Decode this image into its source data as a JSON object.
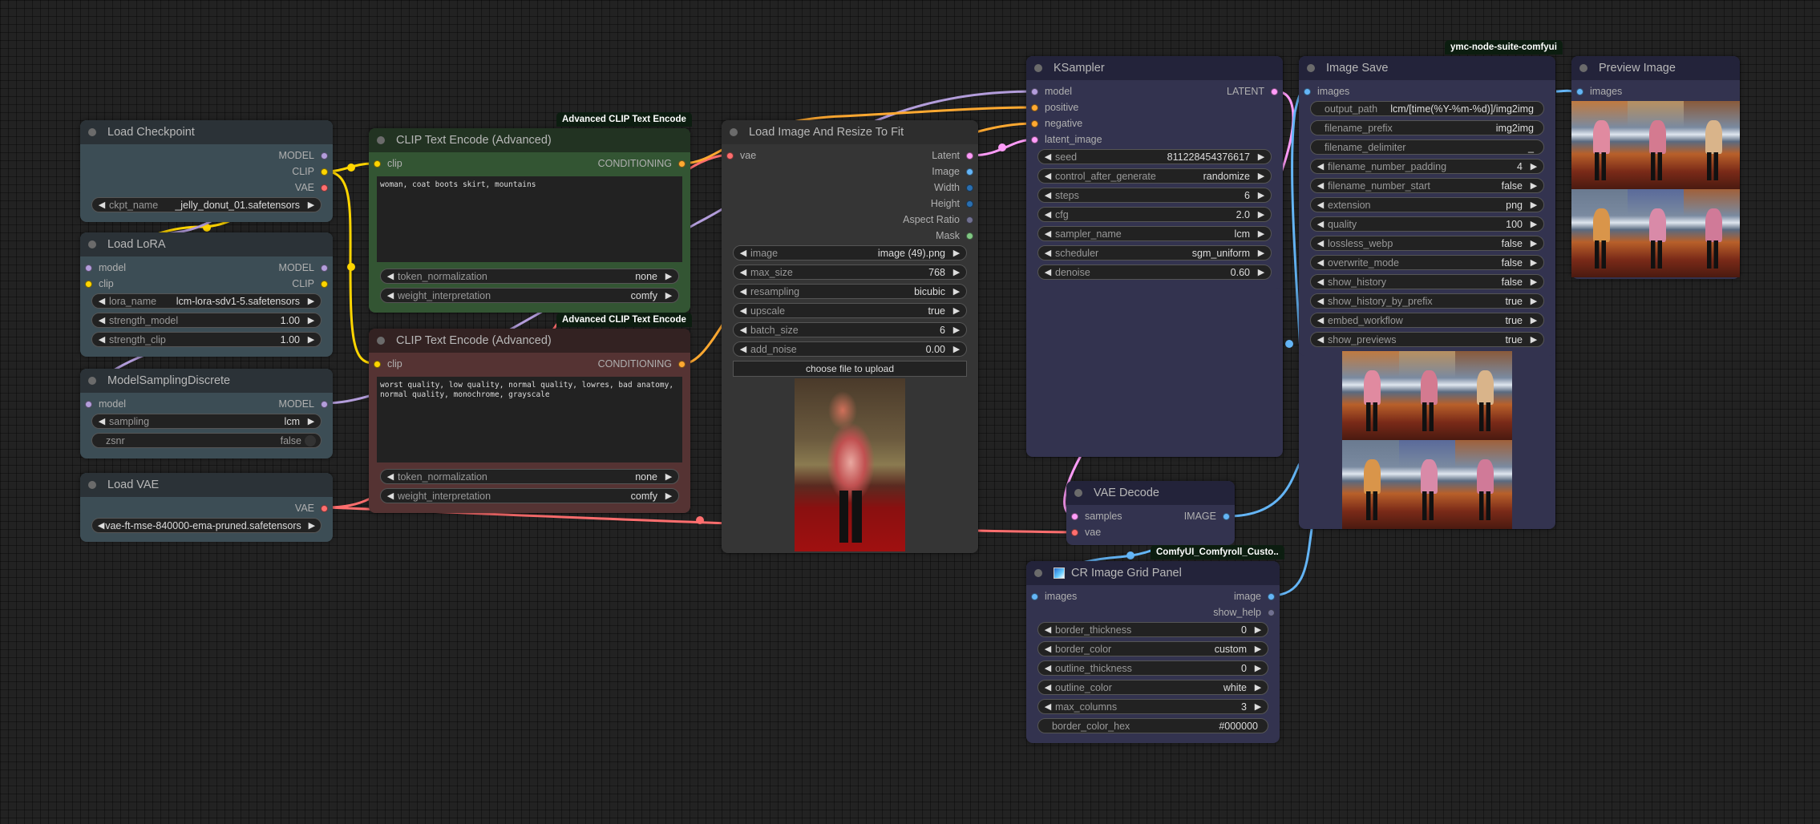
{
  "colors": {
    "model": "#b39ddb",
    "clip": "#ffd500",
    "vae": "#ff6e6e",
    "conditioning": "#ffa931",
    "latent": "#ff9cf9",
    "image": "#64b5f6",
    "int": "#2a6fb0",
    "float": "#707090",
    "mask": "#81c784"
  },
  "nodes": {
    "load_checkpoint": {
      "title": "Load Checkpoint",
      "outputs": [
        "MODEL",
        "CLIP",
        "VAE"
      ],
      "widgets": [
        {
          "name": "ckpt_name",
          "value": "_jelly_donut_01.safetensors"
        }
      ]
    },
    "load_lora": {
      "title": "Load LoRA",
      "inputs": [
        "model",
        "clip"
      ],
      "outputs": [
        "MODEL",
        "CLIP"
      ],
      "widgets": [
        {
          "name": "lora_name",
          "value": "lcm-lora-sdv1-5.safetensors"
        },
        {
          "name": "strength_model",
          "value": "1.00"
        },
        {
          "name": "strength_clip",
          "value": "1.00"
        }
      ]
    },
    "model_sampling": {
      "title": "ModelSamplingDiscrete",
      "inputs": [
        "model"
      ],
      "outputs": [
        "MODEL"
      ],
      "widgets": [
        {
          "name": "sampling",
          "value": "lcm"
        },
        {
          "name": "zsnr",
          "value": "false"
        }
      ]
    },
    "load_vae": {
      "title": "Load VAE",
      "outputs": [
        "VAE"
      ],
      "widgets": [
        {
          "name": "vae_name",
          "value": "vae-ft-mse-840000-ema-pruned.safetensors"
        }
      ]
    },
    "clip_positive": {
      "badge": "Advanced CLIP Text Encode",
      "title": "CLIP Text Encode (Advanced)",
      "inputs": [
        "clip"
      ],
      "outputs": [
        "CONDITIONING"
      ],
      "text": "woman, coat boots skirt, mountains",
      "widgets": [
        {
          "name": "token_normalization",
          "value": "none"
        },
        {
          "name": "weight_interpretation",
          "value": "comfy"
        }
      ]
    },
    "clip_negative": {
      "badge": "Advanced CLIP Text Encode",
      "title": "CLIP Text Encode (Advanced)",
      "inputs": [
        "clip"
      ],
      "outputs": [
        "CONDITIONING"
      ],
      "text": "worst quality, low quality, normal quality, lowres, bad anatomy,\nnormal quality, monochrome, grayscale",
      "widgets": [
        {
          "name": "token_normalization",
          "value": "none"
        },
        {
          "name": "weight_interpretation",
          "value": "comfy"
        }
      ]
    },
    "load_image": {
      "title": "Load Image And Resize To Fit",
      "inputs": [
        "vae"
      ],
      "outputs": [
        "Latent",
        "Image",
        "Width",
        "Height",
        "Aspect Ratio",
        "Mask"
      ],
      "widgets": [
        {
          "name": "image",
          "value": "image (49).png"
        },
        {
          "name": "max_size",
          "value": "768"
        },
        {
          "name": "resampling",
          "value": "bicubic"
        },
        {
          "name": "upscale",
          "value": "true"
        },
        {
          "name": "batch_size",
          "value": "6"
        },
        {
          "name": "add_noise",
          "value": "0.00"
        }
      ],
      "upload_label": "choose file to upload"
    },
    "ksampler": {
      "title": "KSampler",
      "inputs": [
        "model",
        "positive",
        "negative",
        "latent_image"
      ],
      "outputs": [
        "LATENT"
      ],
      "widgets": [
        {
          "name": "seed",
          "value": "811228454376617"
        },
        {
          "name": "control_after_generate",
          "value": "randomize"
        },
        {
          "name": "steps",
          "value": "6"
        },
        {
          "name": "cfg",
          "value": "2.0"
        },
        {
          "name": "sampler_name",
          "value": "lcm"
        },
        {
          "name": "scheduler",
          "value": "sgm_uniform"
        },
        {
          "name": "denoise",
          "value": "0.60"
        }
      ]
    },
    "vae_decode": {
      "title": "VAE Decode",
      "inputs": [
        "samples",
        "vae"
      ],
      "outputs": [
        "IMAGE"
      ]
    },
    "cr_grid": {
      "badge": "ComfyUI_Comfyroll_Custo..",
      "title": "CR Image Grid Panel",
      "inputs": [
        "images"
      ],
      "outputs": [
        "image",
        "show_help"
      ],
      "widgets": [
        {
          "name": "border_thickness",
          "value": "0"
        },
        {
          "name": "border_color",
          "value": "custom"
        },
        {
          "name": "outline_thickness",
          "value": "0"
        },
        {
          "name": "outline_color",
          "value": "white"
        },
        {
          "name": "max_columns",
          "value": "3"
        },
        {
          "name": "border_color_hex",
          "value": "#000000"
        }
      ]
    },
    "image_save": {
      "badge": "ymc-node-suite-comfyui",
      "title": "Image Save",
      "inputs": [
        "images"
      ],
      "widgets": [
        {
          "name": "output_path",
          "value": "lcm/[time(%Y-%m-%d)]/img2img"
        },
        {
          "name": "filename_prefix",
          "value": "img2img"
        },
        {
          "name": "filename_delimiter",
          "value": "_"
        },
        {
          "name": "filename_number_padding",
          "value": "4"
        },
        {
          "name": "filename_number_start",
          "value": "false"
        },
        {
          "name": "extension",
          "value": "png"
        },
        {
          "name": "quality",
          "value": "100"
        },
        {
          "name": "lossless_webp",
          "value": "false"
        },
        {
          "name": "overwrite_mode",
          "value": "false"
        },
        {
          "name": "show_history",
          "value": "false"
        },
        {
          "name": "show_history_by_prefix",
          "value": "true"
        },
        {
          "name": "embed_workflow",
          "value": "true"
        },
        {
          "name": "show_previews",
          "value": "true"
        }
      ]
    },
    "preview_image": {
      "title": "Preview Image",
      "inputs": [
        "images"
      ]
    }
  }
}
